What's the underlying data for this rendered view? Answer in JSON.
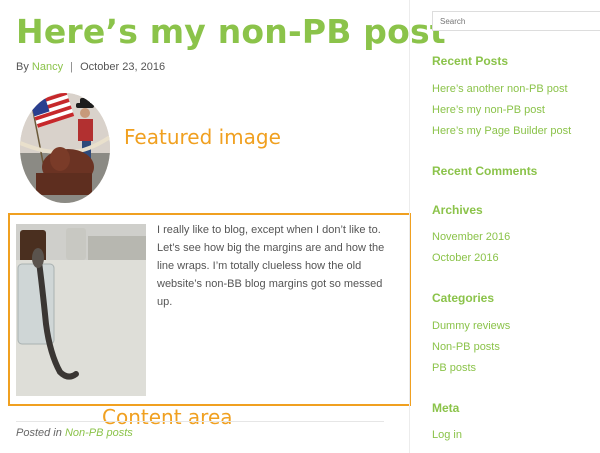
{
  "post": {
    "title": "Here’s my non-PB post",
    "byline_prefix": "By",
    "author": "Nancy",
    "separator": "|",
    "date": "October 23, 2016",
    "body": "I really like to blog, except when I don’t like to. Let’s see how big the margins are and how the line wraps. I’m totally clueless how the old website’s non-BB blog margins got so messed up.",
    "posted_in_label": "Posted in",
    "category": "Non-PB posts"
  },
  "annotations": {
    "featured": "Featured image",
    "content": "Content area",
    "color": "#f0a020"
  },
  "sidebar": {
    "search_placeholder": "Search",
    "recent_posts": {
      "title": "Recent Posts",
      "items": [
        "Here’s another non-PB post",
        "Here’s my non-PB post",
        "Here’s my Page Builder post"
      ]
    },
    "recent_comments": {
      "title": "Recent Comments"
    },
    "archives": {
      "title": "Archives",
      "items": [
        "November 2016",
        "October 2016"
      ]
    },
    "categories": {
      "title": "Categories",
      "items": [
        "Dummy reviews",
        "Non-PB posts",
        "PB posts"
      ]
    },
    "meta": {
      "title": "Meta",
      "items": [
        "Log in"
      ]
    }
  },
  "colors": {
    "accent": "#8bc34a",
    "annotation": "#f0a020"
  }
}
